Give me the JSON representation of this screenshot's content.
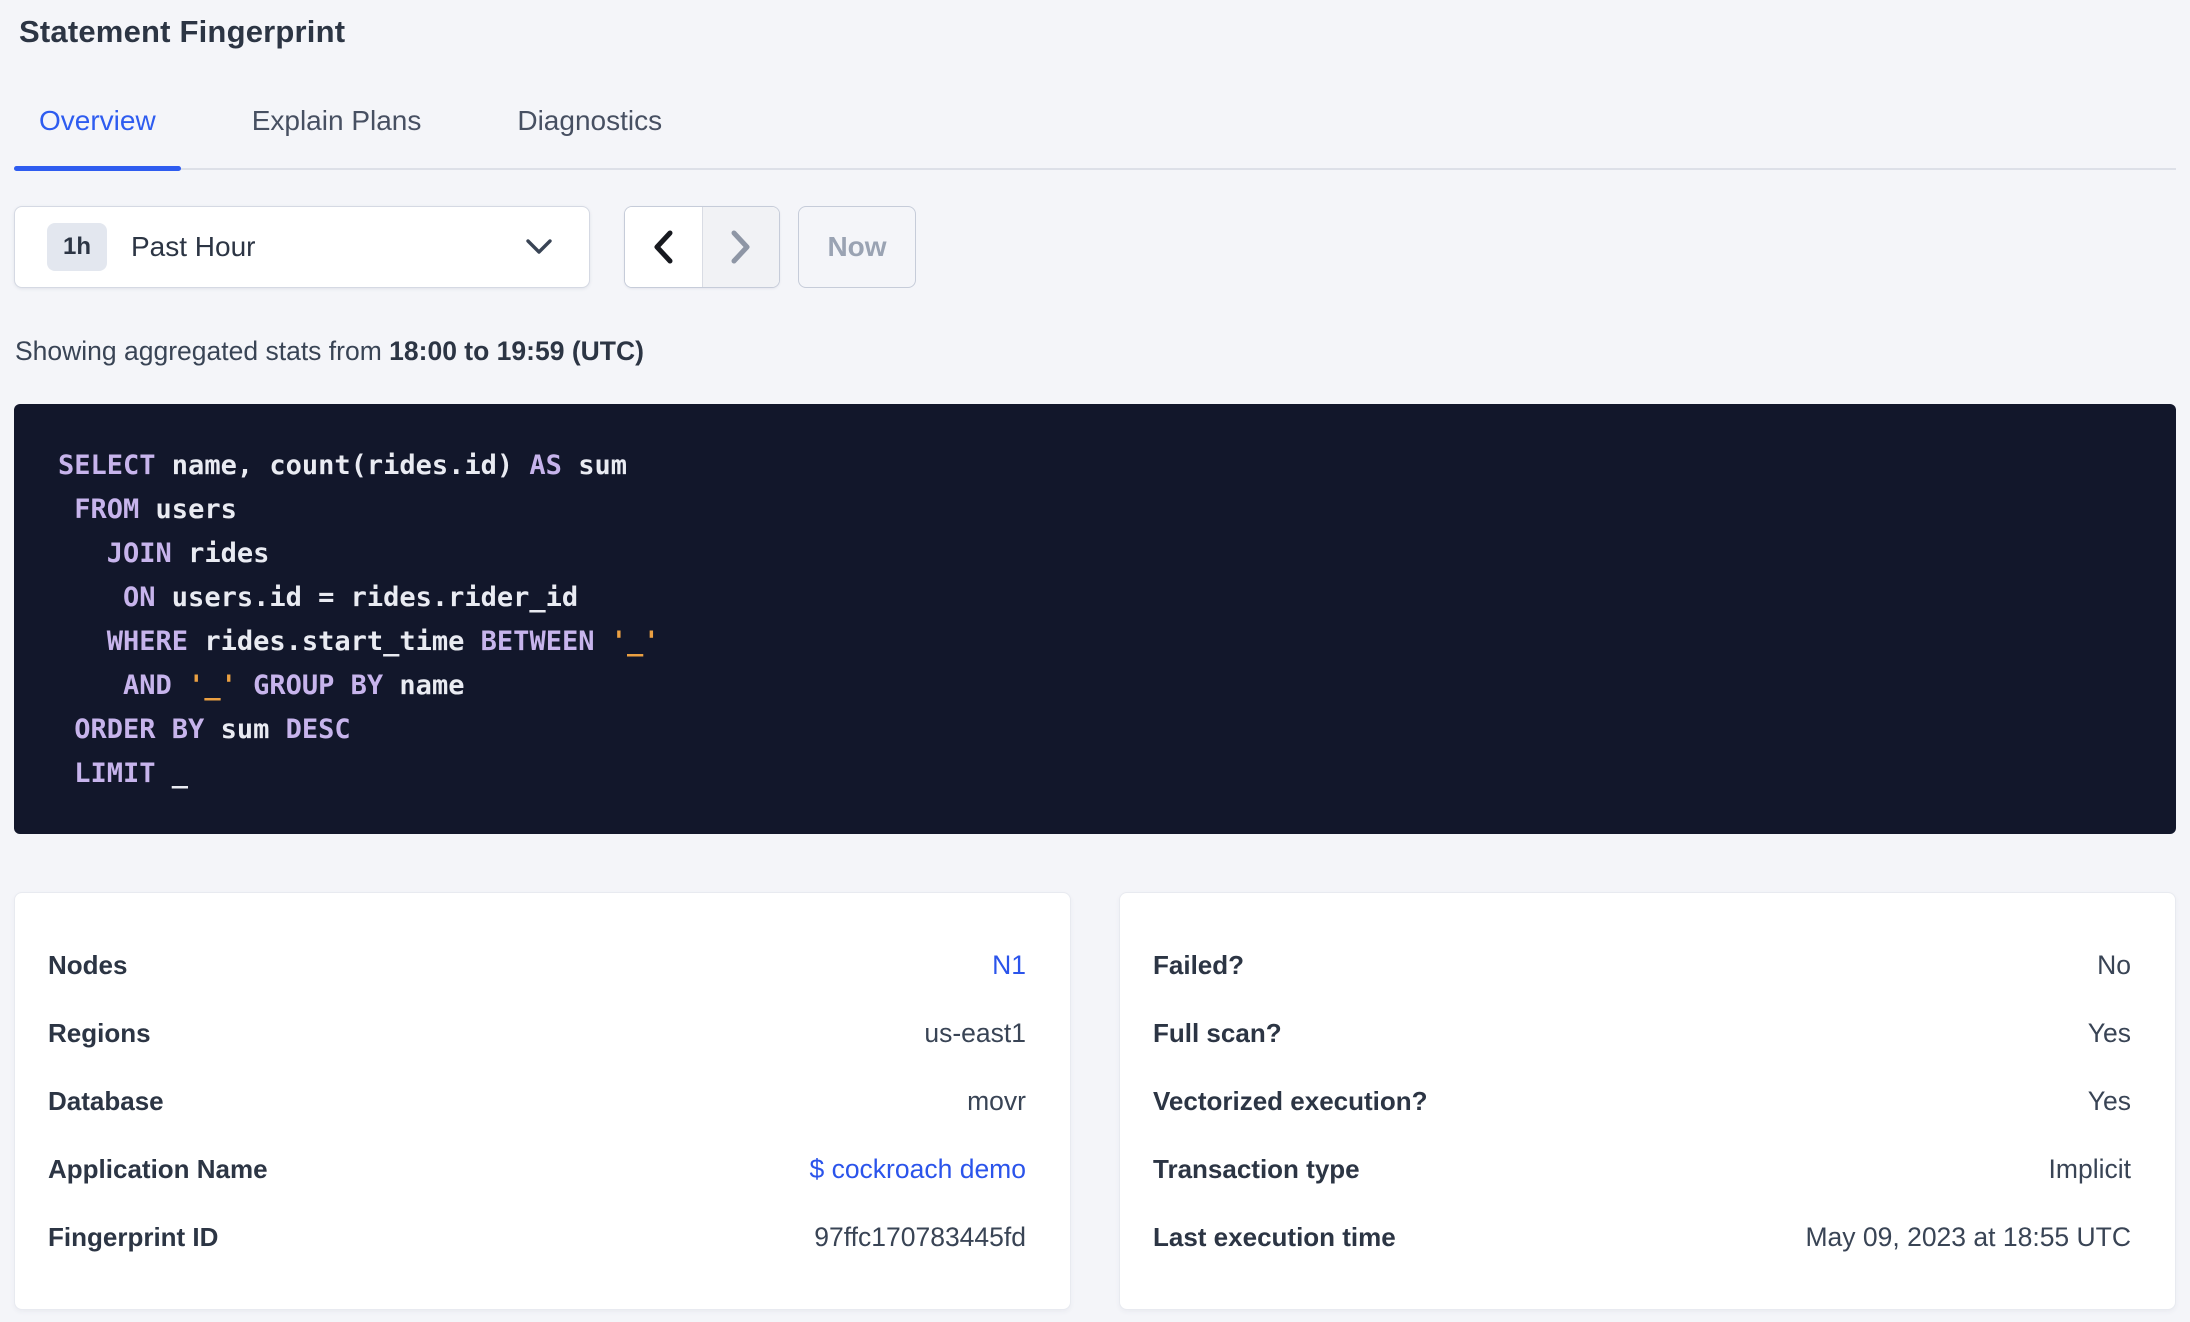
{
  "page": {
    "title": "Statement Fingerprint"
  },
  "tabs": [
    {
      "label": "Overview",
      "active": true
    },
    {
      "label": "Explain Plans",
      "active": false
    },
    {
      "label": "Diagnostics",
      "active": false
    }
  ],
  "time_controls": {
    "range_badge": "1h",
    "range_label": "Past Hour",
    "now_label": "Now",
    "icons": {
      "dropdown": "chevron-down-icon",
      "prev": "chevron-left-icon",
      "next": "chevron-right-icon"
    }
  },
  "caption": {
    "prefix": "Showing aggregated stats from",
    "range": "18:00 to 19:59 (UTC)"
  },
  "sql": {
    "lines": [
      [
        {
          "t": "SELECT",
          "c": "kw"
        },
        {
          "t": " name, count(rides.id) ",
          "c": "id"
        },
        {
          "t": "AS",
          "c": "kw"
        },
        {
          "t": " sum",
          "c": "id"
        }
      ],
      [
        {
          "t": " ",
          "c": "id"
        },
        {
          "t": "FROM",
          "c": "kw"
        },
        {
          "t": " users",
          "c": "id"
        }
      ],
      [
        {
          "t": "   ",
          "c": "id"
        },
        {
          "t": "JOIN",
          "c": "kw"
        },
        {
          "t": " rides",
          "c": "id"
        }
      ],
      [
        {
          "t": "    ",
          "c": "id"
        },
        {
          "t": "ON",
          "c": "kw"
        },
        {
          "t": " users.id = rides.rider_id",
          "c": "id"
        }
      ],
      [
        {
          "t": "   ",
          "c": "id"
        },
        {
          "t": "WHERE",
          "c": "kw"
        },
        {
          "t": " rides.start_time ",
          "c": "id"
        },
        {
          "t": "BETWEEN",
          "c": "kw"
        },
        {
          "t": " ",
          "c": "id"
        },
        {
          "t": "'_'",
          "c": "str"
        }
      ],
      [
        {
          "t": "    ",
          "c": "id"
        },
        {
          "t": "AND",
          "c": "kw"
        },
        {
          "t": " ",
          "c": "id"
        },
        {
          "t": "'_'",
          "c": "str"
        },
        {
          "t": " ",
          "c": "id"
        },
        {
          "t": "GROUP BY",
          "c": "kw"
        },
        {
          "t": " name",
          "c": "id"
        }
      ],
      [
        {
          "t": " ",
          "c": "id"
        },
        {
          "t": "ORDER BY",
          "c": "kw"
        },
        {
          "t": " sum ",
          "c": "id"
        },
        {
          "t": "DESC",
          "c": "kw"
        }
      ],
      [
        {
          "t": " ",
          "c": "id"
        },
        {
          "t": "LIMIT",
          "c": "kw"
        },
        {
          "t": " _",
          "c": "id"
        }
      ]
    ]
  },
  "details_left": {
    "rows": [
      {
        "label": "Nodes",
        "value": "N1",
        "link": true
      },
      {
        "label": "Regions",
        "value": "us-east1",
        "link": false
      },
      {
        "label": "Database",
        "value": "movr",
        "link": false
      },
      {
        "label": "Application Name",
        "value": "$ cockroach demo",
        "link": true
      },
      {
        "label": "Fingerprint ID",
        "value": "97ffc170783445fd",
        "link": false
      }
    ]
  },
  "details_right": {
    "rows": [
      {
        "label": "Failed?",
        "value": "No",
        "link": false
      },
      {
        "label": "Full scan?",
        "value": "Yes",
        "link": false
      },
      {
        "label": "Vectorized execution?",
        "value": "Yes",
        "link": false
      },
      {
        "label": "Transaction type",
        "value": "Implicit",
        "link": false
      },
      {
        "label": "Last execution time",
        "value": "May 09, 2023 at 18:55 UTC",
        "link": false
      }
    ]
  },
  "colors": {
    "page_background": "#f4f5f9",
    "accent_blue": "#2e5cf0",
    "link_blue": "#2b54eb",
    "heading_text": "#2c3544",
    "body_text": "#394455",
    "disabled_text": "#9aa3b3",
    "sql_background": "#12172b",
    "sql_keyword": "#c7b4ec",
    "sql_identifier": "#e9ebf2",
    "sql_string": "#eba042"
  }
}
